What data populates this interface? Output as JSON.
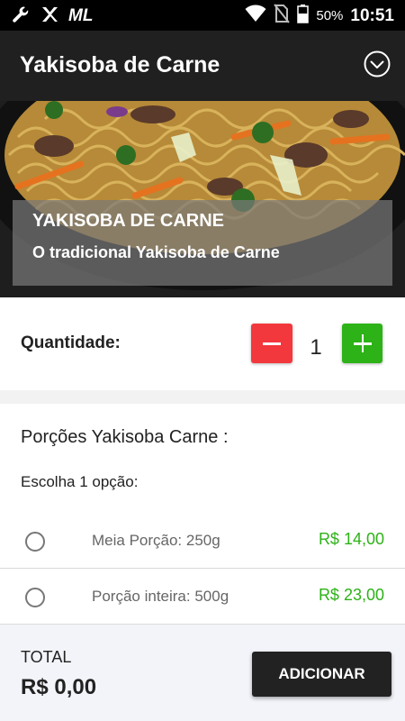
{
  "status_bar": {
    "icons_left": [
      "wrench-icon",
      "app-logo-icon",
      "ml-icon"
    ],
    "ml_text": "ML",
    "battery_percent": "50%",
    "time": "10:51"
  },
  "app_bar": {
    "title": "Yakisoba de Carne"
  },
  "hero": {
    "caption_title": "YAKISOBA DE CARNE",
    "caption_subtitle": "O tradicional Yakisoba de Carne"
  },
  "quantity": {
    "label": "Quantidade:",
    "value": "1"
  },
  "options": {
    "title": "Porções Yakisoba Carne :",
    "instruction": "Escolha 1 opção:",
    "items": [
      {
        "name": "Meia Porção: 250g",
        "price": "R$ 14,00"
      },
      {
        "name": "Porção inteira: 500g",
        "price": "R$ 23,00"
      }
    ]
  },
  "footer": {
    "total_label": "TOTAL",
    "total_value": "R$ 0,00",
    "add_label": "ADICIONAR"
  },
  "colors": {
    "app_bar": "#202020",
    "minus": "#f2383d",
    "plus": "#2db217",
    "price": "#2db217",
    "add_button": "#222222"
  }
}
